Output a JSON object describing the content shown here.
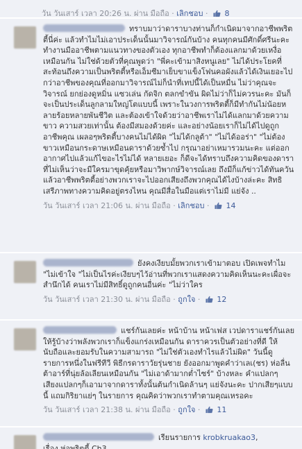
{
  "top_meta": {
    "timestamp": "วัน วันเสาร์ เวลา 20:26 น. ผ่าน มือถือ",
    "action": "เลิกชอบ",
    "like_count": "8"
  },
  "comments": [
    {
      "name": "",
      "text": "ทราบมาว่าดาราบางท่านก็กำเนิดมาจากอาชีพพริตตี้นี่ค่ะ แล้วทำไมไม่เอาประเด็นนั้นมาวิจารณ์กันบ้าง คนทุกคนมีศักดิ์ศรีนะคะ ทำงานมืออาชีพตามแนวทางของตัวเอง ทุกอาชีพทำก็ต้องแลกมาด้วยเหงื่อเหมือนกัน ไม่ใช่ด้วยตัวที่คุณพูดว่า \"พี่คะเข้ามาสิงหนูเลย\" ไม่ได้ประโยคที่สะท้อนถึงความเป็นพริตตี้หรือเอ็มซีมาเย็บขาแข็งโฟนคอผังแล้วได้เงินเยอะไปกว่าอาชีพของคุณที่ออกมาวิจารณ์ไม่ก็นำที่เทปนี้ได้เป็นหมื่น ไม่ว่าคุณจะวิจารณ์ ยกย่องดูหมิ่น แซวเล่น กัดจิก ตลกขำขัน ผิดไม่ว่าก็ไม่ควรนะคะ มันก็จะเป็นประเด็นลูกลามใหญ่โตแบบนี้ เพราะในวงการพริตตี้ก็มีทำกันไม่น้อยหลายร้อยหลายพันชีวิต และต้องเข้าใจด้วยว่าอาชีพเราไม่ได้แลกมาด้วยความขาว ความสวยเท่านั้น ต้องมีสมองด้วยค่ะ และอย่างน้อยเราก็ไม่ได้ไปดูถูกอาชีพคุณ เผลอๆพริตตี้บางคนไม่ได้ผิด \"ไม่ได้กลูต้า\" \"ไม่ได้ออร่า\" \"ไม่ต้องขาวเหมือนกระดาษเหมือนดาราด้วยซ้ำไป กรุณาอย่าเหมารวมนะคะ แต่ออกอากาศไปแล้วแก้ไขอะไรไม่ได้ หลายเยอะ ก็ดีจะได้ทราบถึงความคิดของดาราที่ไม่เห็นว่าจะมีใครมาขุดคุ้ยหรือมาวิพากษ์วิจารณ์เลย ถึงมีก็แก้ข่าวได้ทันควัน แล้วอาชีพพริตตี้อย่างพวกเราจะไปออกเสียงถึงพวกคุณได้ไงบ้างล่ะคะ สิทธิเสรีภาพทางความคิดอยู่ตรงไหน คุณมีสื่อในมือแต่เราไม่มี แย่จัง ..",
      "timestamp": "วัน วันเสาร์ เวลา 21:06 น. ผ่าน มือถือ",
      "action": "เลิกชอบ",
      "like_count": "14"
    },
    {
      "name": "",
      "text": "ยังคงเงียบมั้ยพวกเราเข้ามาตอบ เปิดเพจทำไม \"ไม่เข้าใจ \"ไม่เป็นไรค่ะเงียบๆไว้อ่านที่พวกเราแสดงความคิดเห็นนะคะเผื่อจะสำนึกได้ คนเราไม่มีสิทธิ์ดูถูกคนอื่นค่ะ \"ไม่ว่าใคร",
      "timestamp": "วัน วันเสาร์ เวลา 21:30 น. ผ่าน มือถือ",
      "action": "ถูกใจ",
      "like_count": "12"
    },
    {
      "name": "",
      "text": "แชร์กันเลยค่ะ หน้าบ้าน หน้าเฟส เวปดาราแชร์กันเลย ให้รู้บ้างว่าพลังพวกเราก็แข็งแกร่งเหมือนกัน ดาราควรเป็นตัวอย่างที่ดี ให้นับถือและยอมรับในความสามารถ \"ไม่ใช่ตัวเองทำไรแล้วไม่ผิด\" วันนี้ดูรายการหนึ่งในฟรีทีวี พิธีกรดาราวัยรุ่นชาย ยังออกมาพูดคำว่าเลเ(ชร) ห่อลื่นต้าอาร์ที่นุ่ยล้อเลียนเหมือนกัน \"ไม่เอาด้ามากต่ำไซร์\" บ้างหละ คำแปลกๆ เสียงแปลกๆก็เอามาจากดาราทั้งนั้นต้นกำเนิดล้านๆ แย่จังนะคะ ปากเสียๆแบบนี้ แถมกิริยาแย่ๆ ในรายการ คุณคิดว่าพวกเราทำตามคุณเหรอคะ",
      "timestamp": "วัน วันเสาร์ เวลา 21:38 น. ผ่าน มือถือ",
      "action": "ถูกใจ",
      "like_count": "11"
    },
    {
      "name": "",
      "text": "เรียนรายการ krobkruakao3,",
      "text_link": "krobkruakao3",
      "text2": "เรื่อง ห่อพริตตี้ Ch3"
    }
  ],
  "colors": {
    "background": "#eff1f6",
    "link": "#3b5998",
    "meta": "#8b8f98",
    "text": "#333333"
  }
}
